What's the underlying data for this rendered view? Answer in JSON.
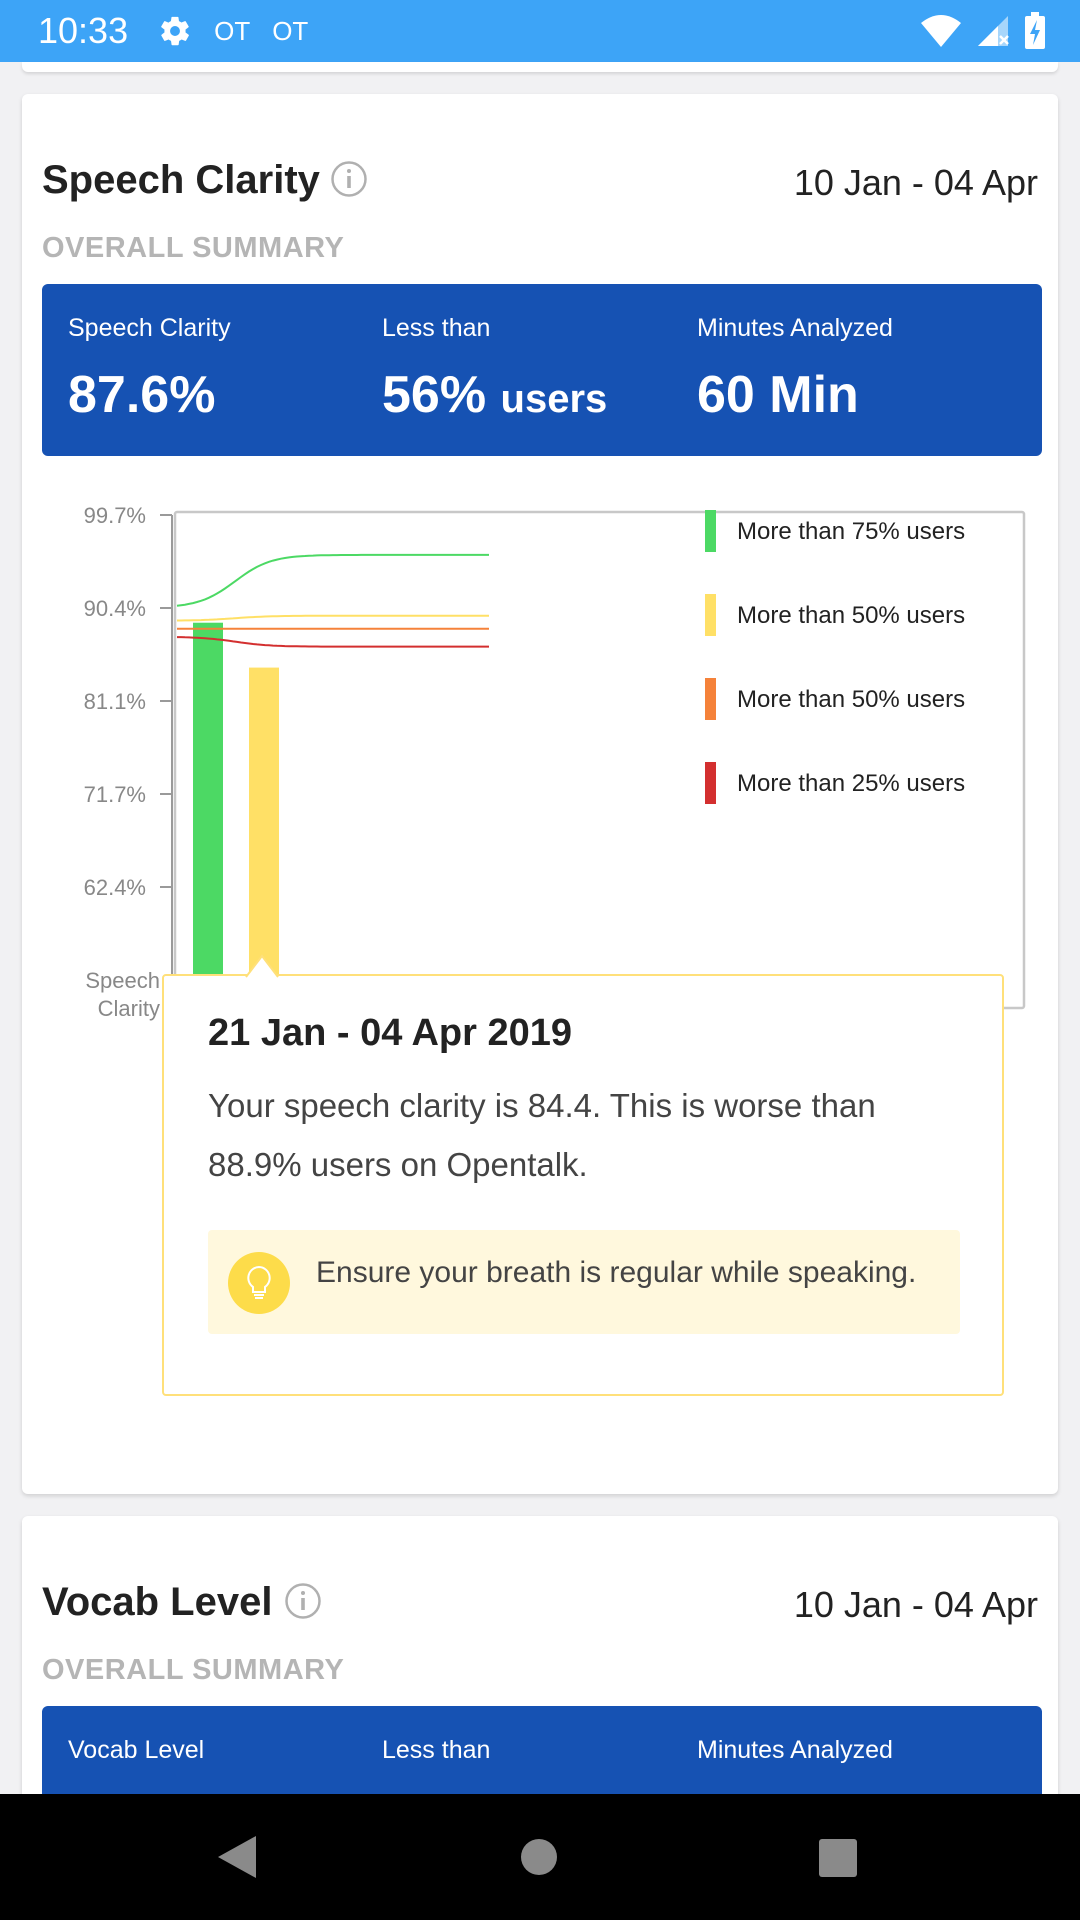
{
  "status_bar": {
    "time": "10:33",
    "indicator_1": "OT",
    "indicator_2": "OT"
  },
  "speech_card": {
    "title": "Speech Clarity",
    "date_range": "10 Jan - 04 Apr",
    "section_label": "OVERALL SUMMARY",
    "summary": {
      "col1_label": "Speech Clarity",
      "col1_value": "87.6%",
      "col2_label": "Less than",
      "col2_value": "56%",
      "col2_unit": "users",
      "col3_label": "Minutes Analyzed",
      "col3_value": "60 Min"
    },
    "tooltip": {
      "title": "21 Jan - 04 Apr 2019",
      "text": "Your speech clarity is 84.4. This is worse than 88.9% users on Opentalk.",
      "hint": "Ensure your breath is regular while speaking."
    }
  },
  "vocab_card": {
    "title": "Vocab Level",
    "date_range": "10 Jan - 04 Apr",
    "section_label": "OVERALL SUMMARY",
    "summary": {
      "col1_label": "Vocab Level",
      "col2_label": "Less than",
      "col3_label": "Minutes Analyzed"
    }
  },
  "chart_data": {
    "type": "bar",
    "ylabel": "Speech Clarity",
    "y_ticks": [
      "99.7%",
      "90.4%",
      "81.1%",
      "71.7%",
      "62.4%"
    ],
    "bars": [
      {
        "value": 88.9,
        "color": "#4cd964"
      },
      {
        "value": 84.4,
        "color": "#ffe066"
      }
    ],
    "series": [
      {
        "name": "More than 75% users",
        "color": "#4cd964",
        "values": [
          90.4,
          95.7
        ]
      },
      {
        "name": "More than 50% users",
        "color": "#ffe066",
        "values": [
          89.1,
          89.6
        ]
      },
      {
        "name": "More than 50% users",
        "color": "#f5823a",
        "values": [
          88.3,
          88.3
        ]
      },
      {
        "name": "More than 25% users",
        "color": "#d32f2f",
        "values": [
          87.5,
          86.5
        ]
      }
    ]
  },
  "colors": {
    "primary": "#1652b3",
    "status_bar": "#3da4f7",
    "accent_yellow": "#ffe07a"
  }
}
